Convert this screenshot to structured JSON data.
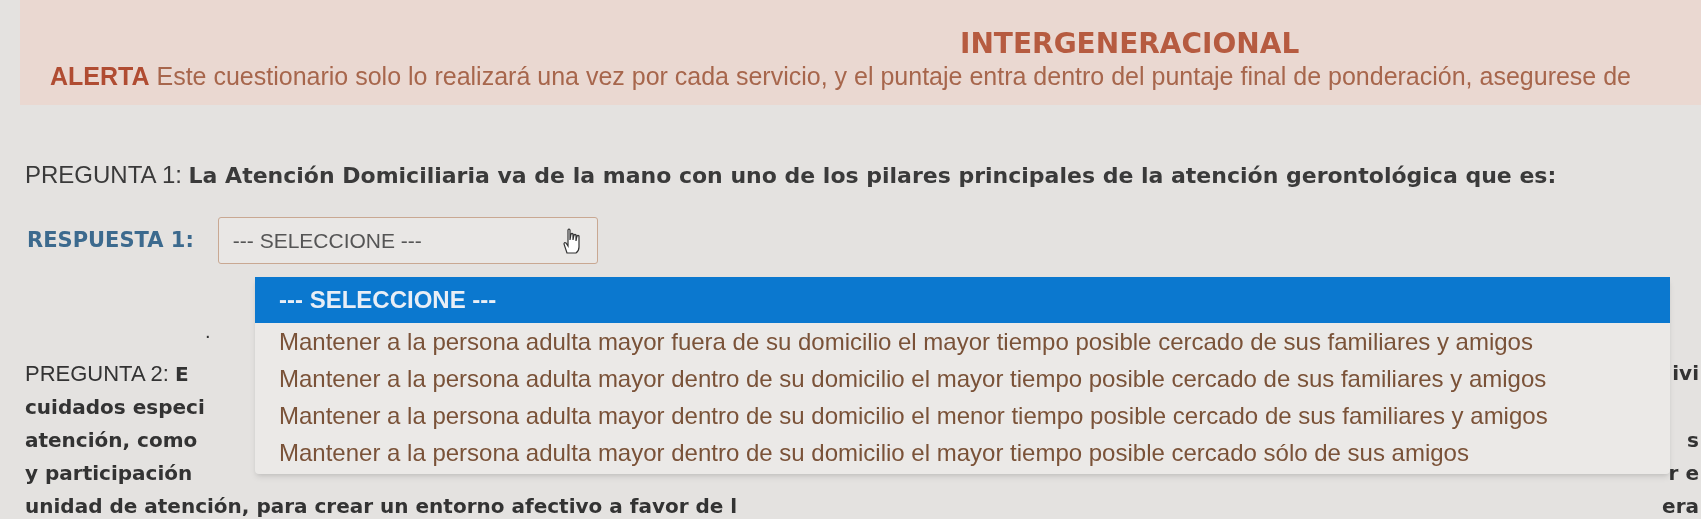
{
  "alert": {
    "title": "INTERGENERACIONAL",
    "label": "ALERTA",
    "message": "Este cuestionario solo lo realizará una vez por cada servicio, y el puntaje entra dentro del puntaje final de ponderación, asegurese de"
  },
  "question_1": {
    "label": "PREGUNTA 1:",
    "text": "La Atención Domiciliaria va de la mano con uno de los pilares principales de la atención gerontológica que es:"
  },
  "answer_1": {
    "label": "RESPUESTA 1:",
    "value": "--- SELECCIONE ---"
  },
  "dropdown": {
    "options": [
      {
        "text": "--- SELECCIONE ---",
        "selected": true
      },
      {
        "text": "Mantener a la persona adulta mayor fuera de su domicilio el mayor tiempo posible cercado de sus familiares y amigos",
        "selected": false
      },
      {
        "text": "Mantener a la persona adulta mayor dentro de su domicilio el mayor tiempo posible cercado de sus familiares y amigos",
        "selected": false
      },
      {
        "text": "Mantener a la persona adulta mayor dentro de su domicilio el menor tiempo posible cercado de sus familiares y amigos",
        "selected": false
      },
      {
        "text": "Mantener a la persona adulta mayor dentro de su domicilio el mayor tiempo posible cercado sólo de sus amigos",
        "selected": false
      }
    ]
  },
  "bullet": ".",
  "question_2": {
    "label": "PREGUNTA 2:",
    "lines": [
      {
        "left": "E",
        "right": "ivi"
      },
      {
        "left": "cuidados especi"
      },
      {
        "left": "atención, como",
        "right": "s"
      },
      {
        "left": "y participación",
        "right": "r e"
      },
      {
        "left": "unidad de atención, para crear un entorno afectivo a favor de l",
        "right": "era"
      }
    ]
  }
}
